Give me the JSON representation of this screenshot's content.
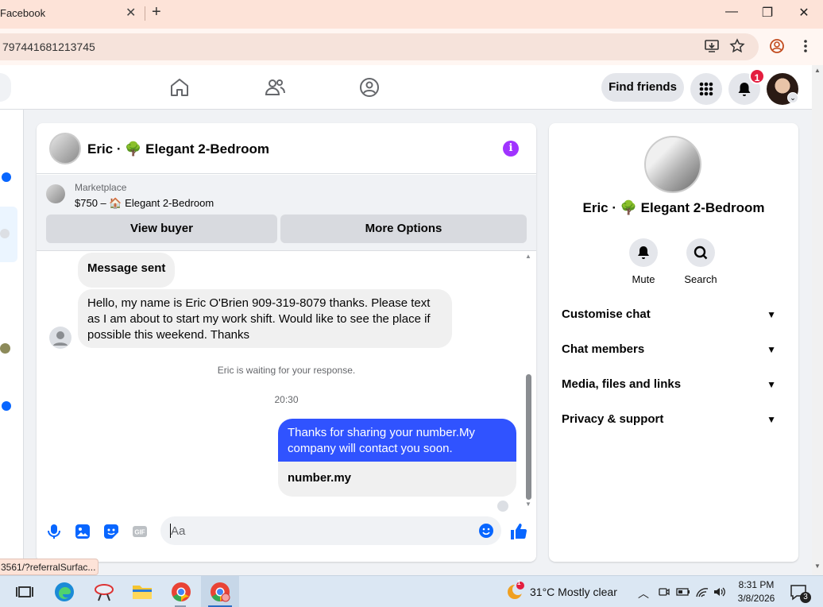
{
  "browser": {
    "tab_title": "Facebook",
    "tab_close": "✕",
    "new_tab": "+",
    "url": "797441681213745",
    "window": {
      "minimize": "—",
      "restore": "❐",
      "close": "✕"
    }
  },
  "header": {
    "find_friends": "Find friends",
    "notifications_count": "1"
  },
  "chat": {
    "title": "Eric · 🌳 Elegant 2-Bedroom",
    "info_glyph": "i",
    "marketplace": {
      "label": "Marketplace",
      "price_line": "$750 – 🏠 Elegant 2-Bedroom",
      "view_buyer": "View buyer",
      "more_options": "More Options"
    },
    "messages": {
      "sent_note": "Message sent",
      "incoming": "Hello, my name is Eric O'Brien 909-319-8079 thanks. Please text as I am about to start my work shift. Would like to see the place if possible this weekend. Thanks",
      "waiting": "Eric is waiting for your response.",
      "time": "20:30",
      "outgoing": "Thanks for sharing your number.My company will contact you soon.",
      "link_preview": "number.my"
    },
    "composer_placeholder": "Aa"
  },
  "details": {
    "name": "Eric · 🌳 Elegant 2-Bedroom",
    "actions": [
      {
        "label": "Mute"
      },
      {
        "label": "Search"
      }
    ],
    "sections": [
      {
        "label": "Customise chat"
      },
      {
        "label": "Chat members"
      },
      {
        "label": "Media, files and links"
      },
      {
        "label": "Privacy & support"
      }
    ]
  },
  "status_url": "3561/?referralSurfac...",
  "taskbar": {
    "weather": "31°C  Mostly clear",
    "weather_badge": "1",
    "time": "8:31 PM",
    "date": "3/8/2026",
    "notification_count": "3"
  },
  "colors": {
    "accent": "#0866ff",
    "outgoing_bubble": "#3053ff",
    "info_purple": "#a033ff",
    "badge_red": "#e41e3f"
  }
}
